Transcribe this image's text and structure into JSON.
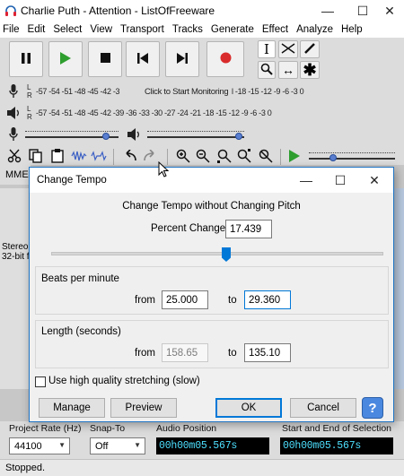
{
  "window": {
    "title": "Charlie Puth - Attention - ListOfFreeware",
    "icon": "headphones-icon",
    "controls": [
      "minimize-icon",
      "maximize-icon",
      "close-icon"
    ]
  },
  "menu": [
    "File",
    "Edit",
    "Select",
    "View",
    "Transport",
    "Tracks",
    "Generate",
    "Effect",
    "Analyze",
    "Help"
  ],
  "meters": {
    "record_scale": "-57 -54 -51 -48 -45 -42 -3",
    "record_prompt": "Click to Start Monitoring",
    "record_scale_right": "l -18 -15 -12  -9  -6  -3  0",
    "playback_scale": "-57 -54 -51 -48 -45 -42 -39 -36 -33 -30 -27 -24 -21 -18 -15 -12  -9  -6  -3  0",
    "channel_l": "L",
    "channel_r": "R"
  },
  "device_toolbar": {
    "host": "MME"
  },
  "track": {
    "info_line1": "Stereo,",
    "info_line2": "32-bit f"
  },
  "selection_toolbar": {
    "project_rate_label": "Project Rate (Hz)",
    "project_rate_value": "44100",
    "snap_to_label": "Snap-To",
    "snap_to_value": "Off",
    "audio_position_label": "Audio Position",
    "audio_position_value": "00h00m05.567s",
    "selection_label": "Start and End of Selection",
    "selection_value": "00h00m05.567s"
  },
  "status": "Stopped.",
  "dialog": {
    "title": "Change Tempo",
    "heading": "Change Tempo without Changing Pitch",
    "percent_change_label": "Percent Change:",
    "percent_change_value": "17.439",
    "slider_position_pct": 17.439,
    "bpm_group": "Beats per minute",
    "bpm_from_label": "from",
    "bpm_from_value": "25.000",
    "bpm_to_label": "to",
    "bpm_to_value": "29.360",
    "length_group": "Length (seconds)",
    "length_from_label": "from",
    "length_from_value": "158.65",
    "length_to_label": "to",
    "length_to_value": "135.10",
    "hq_checkbox_label": "Use high quality stretching (slow)",
    "hq_checked": false,
    "buttons": {
      "manage": "Manage",
      "preview": "Preview",
      "ok": "OK",
      "cancel": "Cancel",
      "help": "?"
    }
  },
  "colors": {
    "accent": "#0078d7",
    "play_green": "#2e9e2e",
    "record_red": "#d92b2b",
    "time_text": "#4de0ff"
  }
}
